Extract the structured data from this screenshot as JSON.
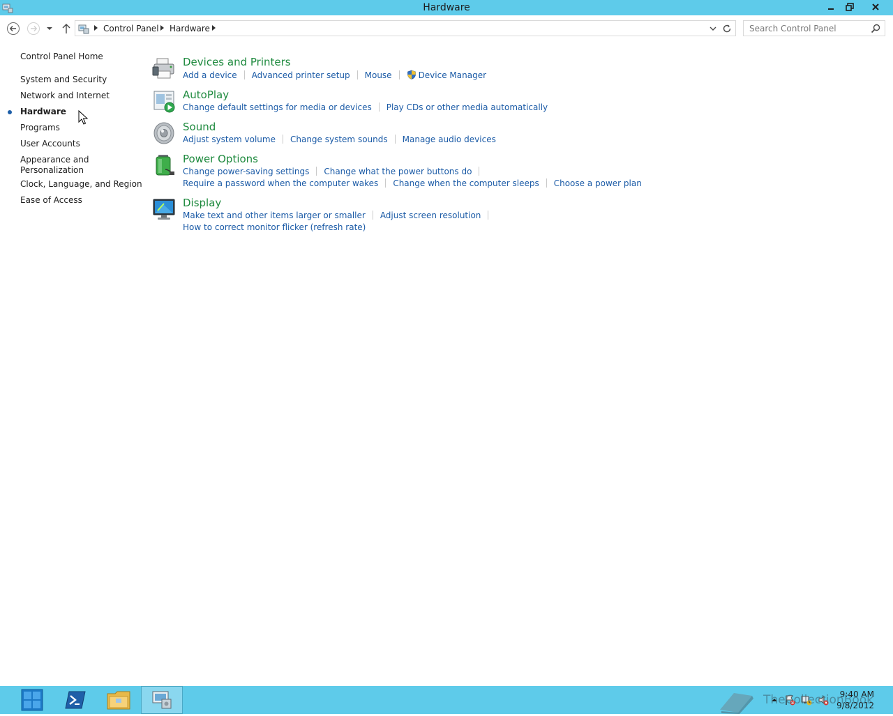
{
  "window": {
    "title": "Hardware"
  },
  "address_bar": {
    "crumbs": [
      "Control Panel",
      "Hardware"
    ]
  },
  "search": {
    "placeholder": "Search Control Panel"
  },
  "left_nav": {
    "home": "Control Panel Home",
    "items": [
      {
        "label": "System and Security",
        "active": false
      },
      {
        "label": "Network and Internet",
        "active": false
      },
      {
        "label": "Hardware",
        "active": true
      },
      {
        "label": "Programs",
        "active": false
      },
      {
        "label": "User Accounts",
        "active": false
      },
      {
        "label": "Appearance and",
        "label2": "Personalization",
        "active": false
      },
      {
        "label": "Clock, Language, and Region",
        "active": false
      },
      {
        "label": "Ease of Access",
        "active": false
      }
    ]
  },
  "categories": [
    {
      "title": "Devices and Printers",
      "icon": "printer-icon",
      "links": [
        "Add a device",
        "Advanced printer setup",
        "Mouse",
        "Device Manager"
      ]
    },
    {
      "title": "AutoPlay",
      "icon": "autoplay-icon",
      "links": [
        "Change default settings for media or devices",
        "Play CDs or other media automatically"
      ]
    },
    {
      "title": "Sound",
      "icon": "speaker-icon",
      "links": [
        "Adjust system volume",
        "Change system sounds",
        "Manage audio devices"
      ]
    },
    {
      "title": "Power Options",
      "icon": "battery-icon",
      "links": [
        "Change power-saving settings",
        "Change what the power buttons do",
        "Require a password when the computer wakes",
        "Change when the computer sleeps",
        "Choose a power plan"
      ]
    },
    {
      "title": "Display",
      "icon": "monitor-icon",
      "links": [
        "Make text and other items larger or smaller",
        "Adjust screen resolution",
        "How to correct monitor flicker (refresh rate)"
      ]
    }
  ],
  "taskbar": {
    "time": "9:40 AM",
    "date": "9/8/2012",
    "watermark": "TheCollectionBook"
  },
  "colors": {
    "chrome": "#5ecbea",
    "category_title": "#1e8a3e",
    "link": "#1a5aa6"
  }
}
